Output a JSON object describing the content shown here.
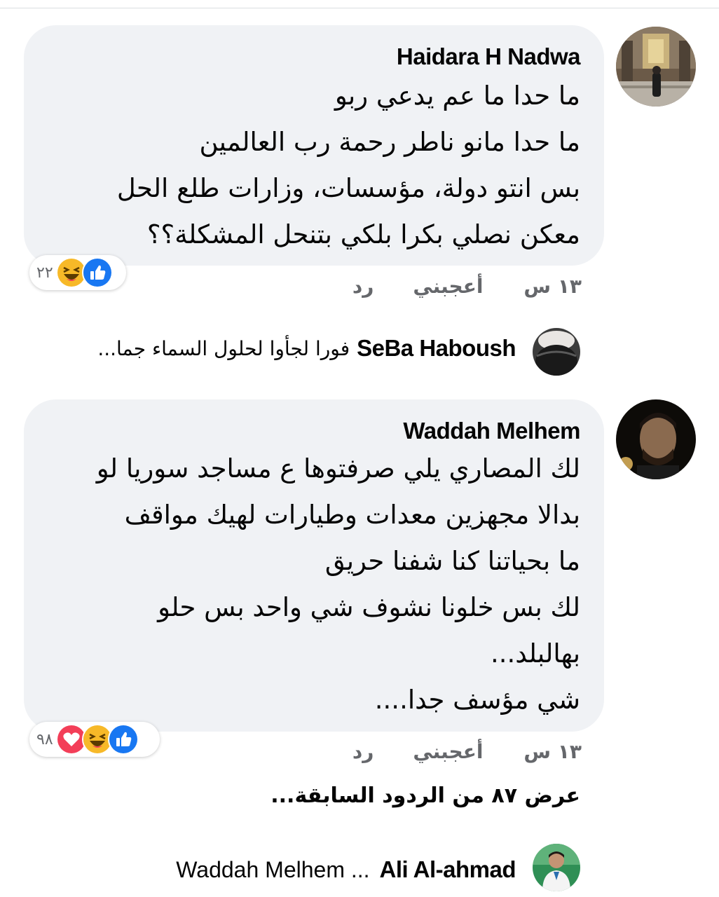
{
  "comments": [
    {
      "author": "Haidara H Nadwa",
      "lines": [
        "ما حدا ما عم يدعي ربو",
        "ما حدا مانو ناطر رحمة رب العالمين",
        "بس انتو دولة، مؤسسات، وزارات طلع الحل",
        "معكن نصلي بكرا بلكي بتنحل المشكلة؟؟"
      ],
      "reaction_count": "٢٢",
      "reaction_icons": [
        "like-icon",
        "haha-icon"
      ],
      "time": "١٣ س",
      "like_label": "أعجبني",
      "reply_label": "رد",
      "reply_preview": {
        "name": "SeBa Haboush",
        "text": "فورا لجأوا لحلول السماء جما..."
      }
    },
    {
      "author": "Waddah Melhem",
      "lines": [
        "لك المصاري يلي صرفتوها ع مساجد سوريا لو",
        "بدالا مجهزين معدات وطيارات لهيك مواقف",
        "ما بحياتنا كنا شفنا حريق",
        "لك بس خلونا نشوف شي واحد بس حلو",
        "بهالبلد...",
        "شي مؤسف جدا...."
      ],
      "reaction_count": "٩٨",
      "reaction_icons": [
        "like-icon",
        "haha-icon",
        "love-icon"
      ],
      "time": "١٣ س",
      "like_label": "أعجبني",
      "reply_label": "رد",
      "more_replies": "عرض ٨٧ من الردود السابقة...",
      "reply_preview": {
        "name": "Ali Al-ahmad",
        "text": "Waddah Melhem ..."
      }
    }
  ],
  "colors": {
    "bubble": "#f0f2f5",
    "like_blue": "#1877f2",
    "haha_yellow": "#f7b928",
    "love_red": "#f33e58",
    "meta_gray": "#65676b"
  }
}
